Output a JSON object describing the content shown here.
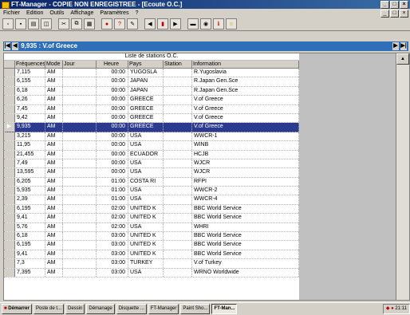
{
  "window": {
    "title": "FT-Manager - COPIE NON ENREGISTREE - [Ecoute O.C.]"
  },
  "menu": [
    "Fichier",
    "Edition",
    "Outils",
    "Affichage",
    "Paramètres",
    "?"
  ],
  "navbar": {
    "record_label": "9,935 : V.of Greece"
  },
  "table": {
    "caption": "Liste de stations O.C.",
    "headers": [
      "Fréquences",
      "Mode",
      "Jour",
      "Heure",
      "Pays",
      "Station",
      "Information"
    ],
    "rows": [
      [
        "7,115",
        "AM",
        "",
        "00:00",
        "YUGOSLA",
        "",
        "R.Yugoslavia"
      ],
      [
        "6,155",
        "AM",
        "",
        "00:00",
        "JAPAN",
        "",
        "R.Japan Gen.Sce"
      ],
      [
        "6,18",
        "AM",
        "",
        "00:00",
        "JAPAN",
        "",
        "R.Japan Gen.Sce"
      ],
      [
        "6,26",
        "AM",
        "",
        "00:00",
        "GREECE",
        "",
        "V.of Greece"
      ],
      [
        "7,45",
        "AM",
        "",
        "00:00",
        "GREECE",
        "",
        "V.of Greece"
      ],
      [
        "9,42",
        "AM",
        "",
        "00:00",
        "GREECE",
        "",
        "V.of Greece"
      ],
      [
        "9,935",
        "AM",
        "",
        "00:00",
        "GREECE",
        "",
        "V.of Greece"
      ],
      [
        "3,215",
        "AM",
        "",
        "00:00",
        "USA",
        "",
        "WWCR-1"
      ],
      [
        "11,95",
        "AM",
        "",
        "00:00",
        "USA",
        "",
        "WINB"
      ],
      [
        "21,455",
        "AM",
        "",
        "00:00",
        "ECUADOR",
        "",
        "HCJB"
      ],
      [
        "7,49",
        "AM",
        "",
        "00:00",
        "USA",
        "",
        "WJCR"
      ],
      [
        "13,595",
        "AM",
        "",
        "00:00",
        "USA",
        "",
        "WJCR"
      ],
      [
        "6,205",
        "AM",
        "",
        "01:00",
        "COSTA RI",
        "",
        "RFPI"
      ],
      [
        "5,935",
        "AM",
        "",
        "01:00",
        "USA",
        "",
        "WWCR-2"
      ],
      [
        "2,39",
        "AM",
        "",
        "01:00",
        "USA",
        "",
        "WWCR-4"
      ],
      [
        "6,195",
        "AM",
        "",
        "02:00",
        "UNITED K",
        "",
        "BBC World Service"
      ],
      [
        "9,41",
        "AM",
        "",
        "02:00",
        "UNITED K",
        "",
        "BBC World Service"
      ],
      [
        "5,76",
        "AM",
        "",
        "02:00",
        "USA",
        "",
        "WHRI"
      ],
      [
        "6,18",
        "AM",
        "",
        "03:00",
        "UNITED K",
        "",
        "BBC World Service"
      ],
      [
        "6,195",
        "AM",
        "",
        "03:00",
        "UNITED K",
        "",
        "BBC World Service"
      ],
      [
        "9,41",
        "AM",
        "",
        "03:00",
        "UNITED K",
        "",
        "BBC World Service"
      ],
      [
        "7,3",
        "AM",
        "",
        "03:00",
        "TURKEY",
        "",
        "V.of Turkey"
      ],
      [
        "7,395",
        "AM",
        "",
        "03:00",
        "USA",
        "",
        "WRNO Worldwide"
      ]
    ],
    "selected_index": 6
  },
  "taskbar": {
    "start": "Démarrer",
    "tasks": [
      "Poste de t...",
      "Dessin",
      "Démanage",
      "Disquette ...",
      "FT-Manager",
      "Paint Sho...",
      "FT-Man..."
    ],
    "active_index": 6,
    "clock": "21:11"
  },
  "colors": {
    "selection": "#2b3a8f",
    "titlebar": "#0a246a",
    "navbar": "#2f6fb8"
  }
}
